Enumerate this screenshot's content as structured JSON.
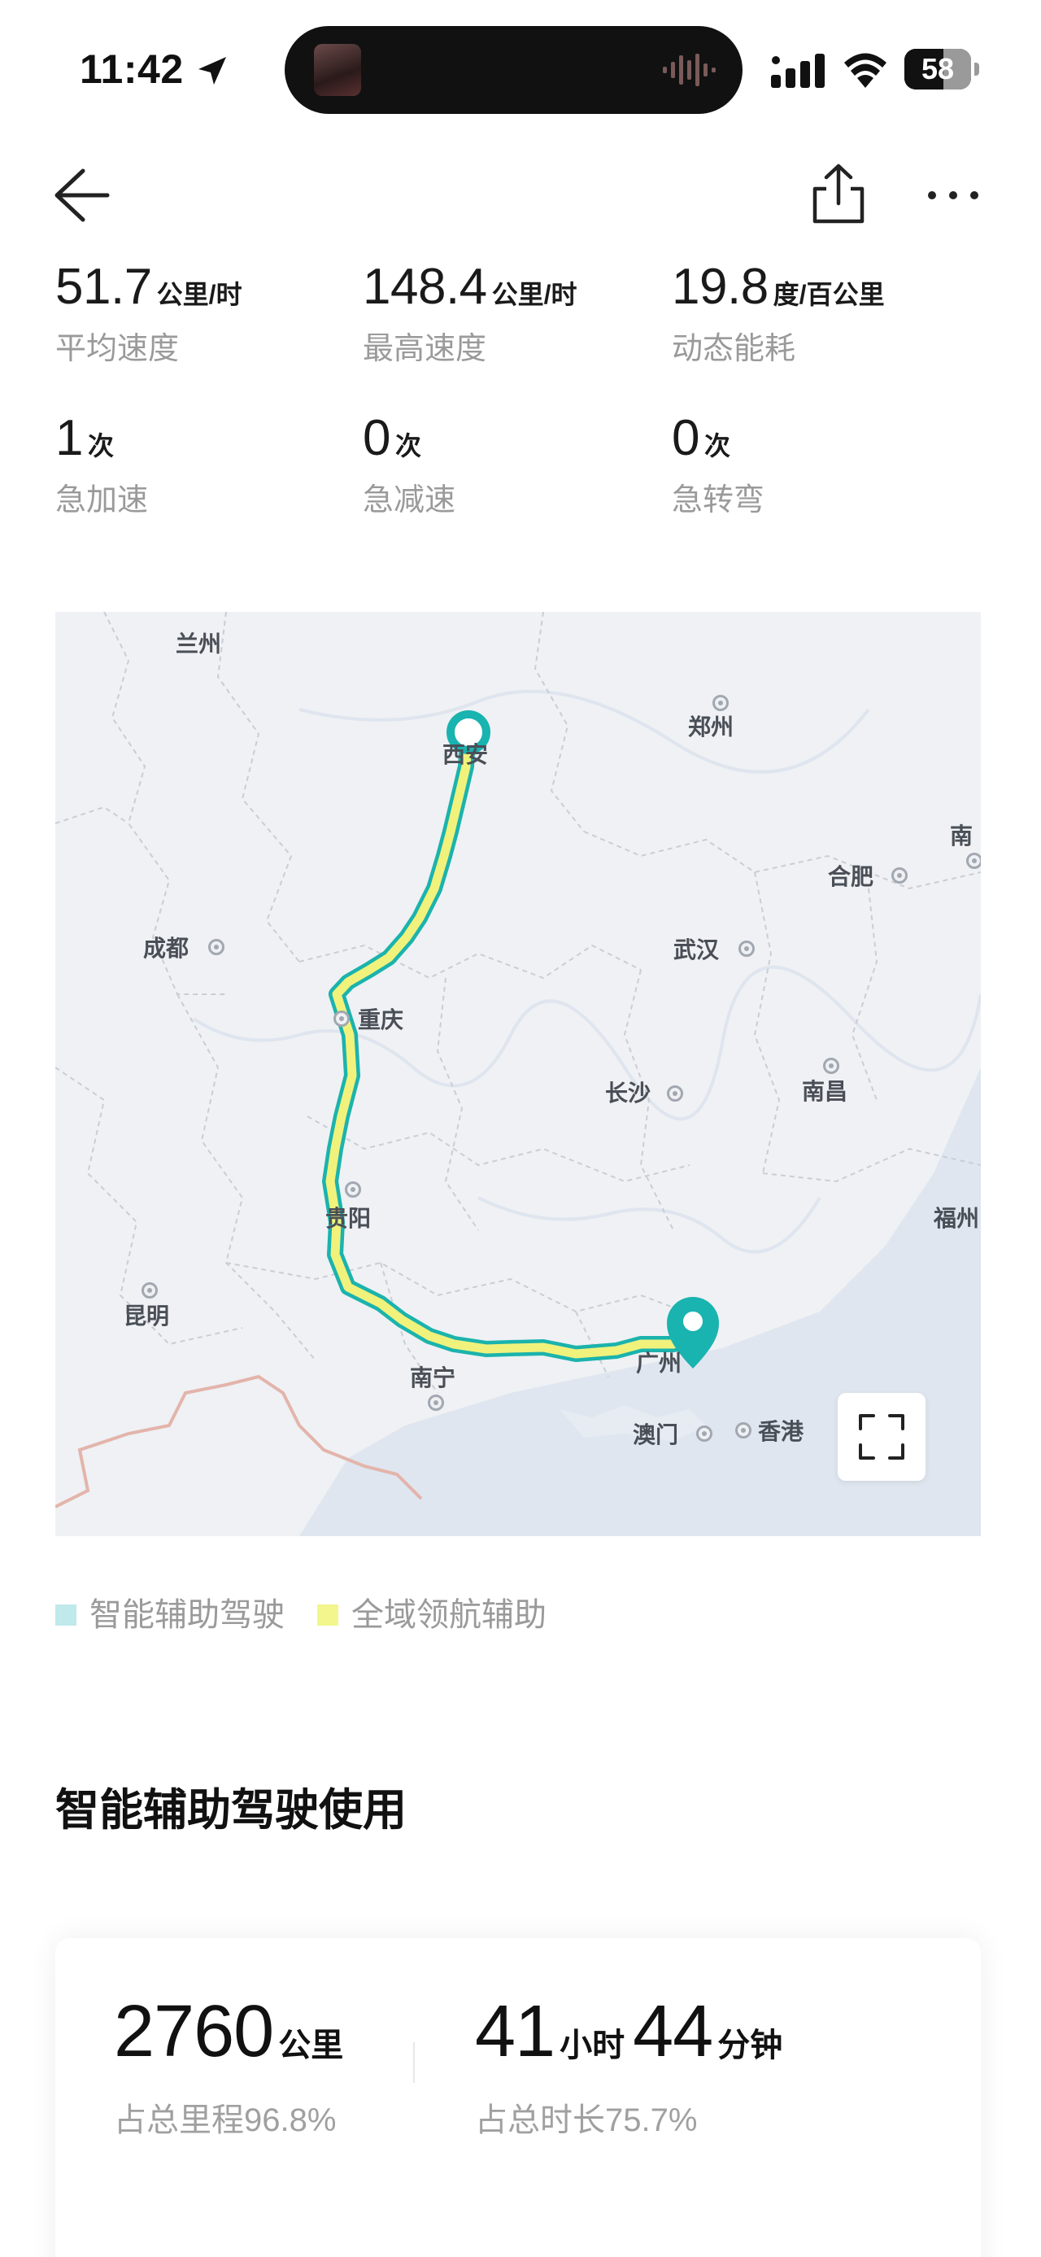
{
  "status_bar": {
    "time": "11:42",
    "battery_level": "58",
    "battery_fraction": 0.58
  },
  "nav": {
    "icons": [
      "back-arrow-icon",
      "share-icon",
      "more-icon"
    ]
  },
  "stats": {
    "avg_speed": {
      "value": "51.7",
      "unit": "公里/时",
      "label": "平均速度"
    },
    "max_speed": {
      "value": "148.4",
      "unit": "公里/时",
      "label": "最高速度"
    },
    "energy": {
      "value": "19.8",
      "unit": "度/百公里",
      "label": "动态能耗"
    },
    "hard_accel": {
      "value": "1",
      "unit": "次",
      "label": "急加速"
    },
    "hard_brake": {
      "value": "0",
      "unit": "次",
      "label": "急减速"
    },
    "sharp_turn": {
      "value": "0",
      "unit": "次",
      "label": "急转弯"
    }
  },
  "map": {
    "cities": {
      "lanzhou": "兰州",
      "xian": "西安",
      "zhengzhou": "郑州",
      "chengdu": "成都",
      "wuhan": "武汉",
      "hefei": "合肥",
      "nan_edge": "南",
      "chongqing": "重庆",
      "changsha": "长沙",
      "nanchang": "南昌",
      "guiyang": "贵阳",
      "fuzhou": "福州",
      "kunming": "昆明",
      "nanning": "南宁",
      "guangzhou_partial": "广州",
      "macau": "澳门",
      "hongkong": "香港"
    },
    "colors": {
      "route_teal": "#1bb3ad",
      "route_yellow": "#f0f27c",
      "pin": "#19b3b0"
    }
  },
  "legend": {
    "items": [
      {
        "label": "智能辅助驾驶",
        "color": "#bfe9ea"
      },
      {
        "label": "全域领航辅助",
        "color": "#f3f68c"
      }
    ]
  },
  "section": {
    "title": "智能辅助驾驶使用"
  },
  "usage": {
    "distance_value": "2760",
    "distance_unit": "公里",
    "distance_share": "占总里程96.8%",
    "hours_value": "41",
    "hours_unit": "小时",
    "minutes_value": "44",
    "minutes_unit": "分钟",
    "time_share": "占总时长75.7%"
  }
}
